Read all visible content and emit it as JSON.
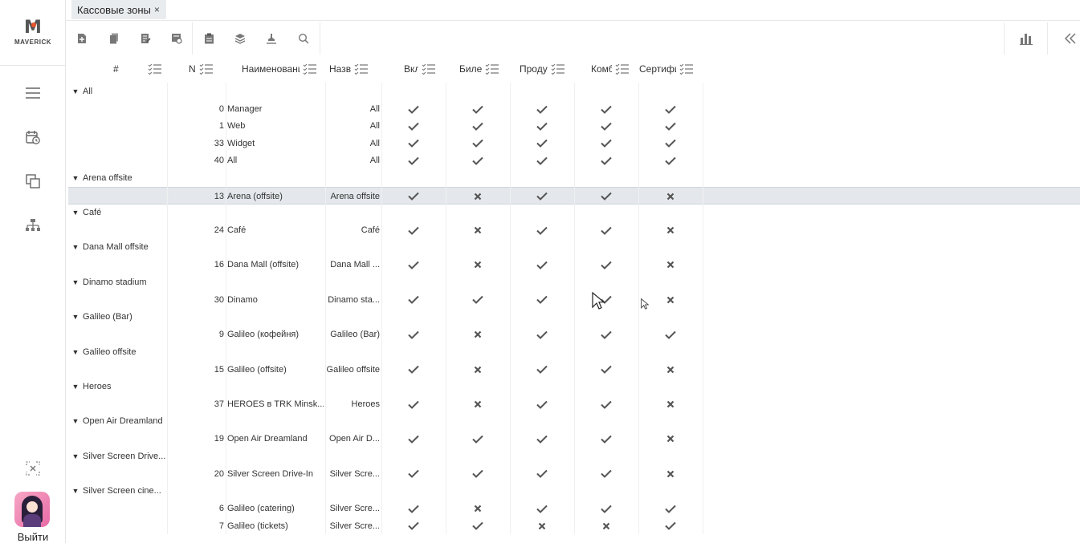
{
  "sidebar": {
    "brand": "MAVERICK",
    "logout_label": "Выйти"
  },
  "tabs": [
    {
      "label": "Кассовые зоны",
      "close": "×"
    }
  ],
  "table": {
    "headers": {
      "index": "#",
      "number": "N",
      "name": "Наименование",
      "zone": "Назв",
      "enabled": "Вкл",
      "tickets": "Билеты",
      "products": "Продукты",
      "combo": "Комбо",
      "certificates": "Сертификаты"
    },
    "groups": [
      {
        "label": "All",
        "rows": [
          {
            "number": "0",
            "name": "Manager",
            "zone": "All",
            "flags": [
              true,
              true,
              true,
              true,
              true
            ]
          },
          {
            "number": "1",
            "name": "Web",
            "zone": "All",
            "flags": [
              true,
              true,
              true,
              true,
              true
            ]
          },
          {
            "number": "33",
            "name": "Widget",
            "zone": "All",
            "flags": [
              true,
              true,
              true,
              true,
              true
            ]
          },
          {
            "number": "40",
            "name": "All",
            "zone": "All",
            "flags": [
              true,
              true,
              true,
              true,
              true
            ]
          }
        ]
      },
      {
        "label": "Arena offsite",
        "rows": [
          {
            "number": "13",
            "name": "Arena (offsite)",
            "zone": "Arena offsite",
            "flags": [
              true,
              false,
              true,
              true,
              false
            ],
            "selected": true
          }
        ]
      },
      {
        "label": "Café",
        "rows": [
          {
            "number": "24",
            "name": "Café",
            "zone": "Café",
            "flags": [
              true,
              false,
              true,
              true,
              false
            ]
          }
        ]
      },
      {
        "label": "Dana Mall offsite",
        "rows": [
          {
            "number": "16",
            "name": "Dana Mall (offsite)",
            "zone": "Dana Mall ...",
            "flags": [
              true,
              false,
              true,
              true,
              false
            ]
          }
        ]
      },
      {
        "label": "Dinamo stadium",
        "rows": [
          {
            "number": "30",
            "name": "Dinamo",
            "zone": "Dinamo sta...",
            "flags": [
              true,
              true,
              true,
              true,
              false
            ]
          }
        ]
      },
      {
        "label": "Galileo (Bar)",
        "rows": [
          {
            "number": "9",
            "name": "Galileo (кофейня)",
            "zone": "Galileo (Bar)",
            "flags": [
              true,
              false,
              true,
              true,
              true
            ]
          }
        ]
      },
      {
        "label": "Galileo offsite",
        "rows": [
          {
            "number": "15",
            "name": "Galileo (offsite)",
            "zone": "Galileo offsite",
            "flags": [
              true,
              false,
              true,
              true,
              false
            ]
          }
        ]
      },
      {
        "label": "Heroes",
        "rows": [
          {
            "number": "37",
            "name": "HEROES в TRK Minsk...",
            "zone": "Heroes",
            "flags": [
              true,
              false,
              true,
              true,
              false
            ]
          }
        ]
      },
      {
        "label": "Open Air Dreamland",
        "rows": [
          {
            "number": "19",
            "name": "Open Air Dreamland",
            "zone": "Open Air D...",
            "flags": [
              true,
              true,
              true,
              true,
              false
            ]
          }
        ]
      },
      {
        "label": "Silver Screen Drive...",
        "rows": [
          {
            "number": "20",
            "name": "Silver Screen Drive-In",
            "zone": "Silver Scre...",
            "flags": [
              true,
              true,
              true,
              true,
              false
            ]
          }
        ]
      },
      {
        "label": "Silver Screen cine...",
        "rows": [
          {
            "number": "6",
            "name": "Galileo (catering)",
            "zone": "Silver Scre...",
            "flags": [
              true,
              false,
              true,
              true,
              true
            ]
          },
          {
            "number": "7",
            "name": "Galileo (tickets)",
            "zone": "Silver Scre...",
            "flags": [
              true,
              true,
              false,
              false,
              true
            ]
          }
        ]
      }
    ]
  }
}
